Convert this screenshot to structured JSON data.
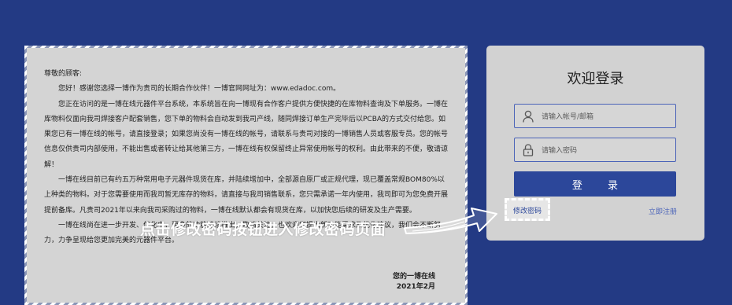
{
  "letter": {
    "greeting": "尊敬的顾客:",
    "paragraphs": [
      "您好！感谢您选择一博作为贵司的长期合作伙伴！一博官网网址为：www.edadoc.com。",
      "您正在访问的是一博在线元器件平台系统，本系统旨在向一博现有合作客户提供方便快捷的在库物料查询及下单服务。一博在库物料仅面向我司焊接客户配套销售，您下单的物料会自动发到我司产线，随同焊接订单生产完毕后以PCBA的方式交付给您。如果您已有一博在线的帐号，请直接登录；如果您尚没有一博在线的帐号，请联系与贵司对接的一博销售人员或客服专员。您的帐号信息仅供贵司内部使用，不能出售或者转让给其他第三方，一博在线有权保留终止异常使用帐号的权利。由此带来的不便，敬请谅解！",
      "一博在线目前已有约五万种常用电子元器件现货在库，并陆续增加中，全部源自原厂或正规代理，现已覆盖常规BOM80%以上种类的物料。对于您需要使用而我司暂无库存的物料，请直接与我司销售联系，您只需承诺一年内使用，我司即可为您免费开展提前备库。凡贵司2021年以来向我司采购过的物料，一博在线默认都会有现货在库，以加快您后续的研发及生产需要。",
      "一博在线尚在进一步开发、优化中，更多的功能陆续推出，敬请关注。也欢迎您提出新功能需求及优化建议，我们会不断努力，力争呈现给您更加完美的元器件平台。"
    ],
    "signature": "您的一博在线",
    "date": "2021年2月"
  },
  "login": {
    "title": "欢迎登录",
    "account_placeholder": "请输入帐号/邮箱",
    "password_placeholder": "请输入密码",
    "login_button": "登 录",
    "forgot_password": "修改密码",
    "register": "立即注册"
  },
  "annotation": {
    "text": "点击修改密码按钮进入修改密码页面"
  },
  "colors": {
    "background": "#233a84",
    "primary_button": "#2c479a",
    "panel": "#d2d2d2"
  },
  "icons": {
    "account_field": "user-icon",
    "password_field": "lock-icon",
    "annotation_arrow": "arrow-right-icon"
  }
}
